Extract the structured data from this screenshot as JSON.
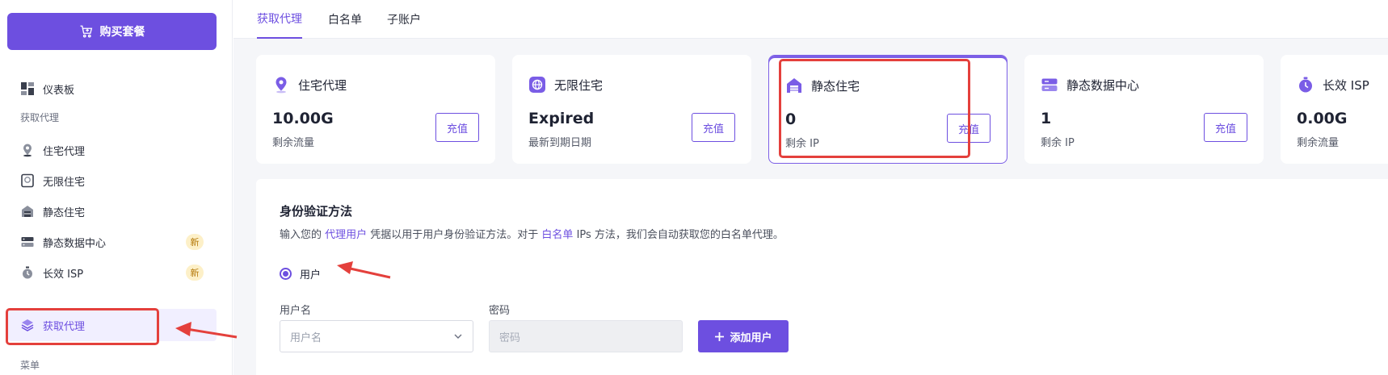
{
  "sidebar": {
    "buy_label": "购买套餐",
    "dashboard_label": "仪表板",
    "section_get_proxy": "获取代理",
    "items": [
      {
        "label": "住宅代理",
        "badge": ""
      },
      {
        "label": "无限住宅",
        "badge": ""
      },
      {
        "label": "静态住宅",
        "badge": ""
      },
      {
        "label": "静态数据中心",
        "badge": "新"
      },
      {
        "label": "长效 ISP",
        "badge": "新"
      },
      {
        "label": "获取代理",
        "badge": ""
      }
    ],
    "section_menu": "菜单"
  },
  "tabs": [
    {
      "label": "获取代理",
      "active": true
    },
    {
      "label": "白名单",
      "active": false
    },
    {
      "label": "子账户",
      "active": false
    }
  ],
  "cards": [
    {
      "title": "住宅代理",
      "value": "10.00G",
      "sub": "剩余流量",
      "button": "充值",
      "icon": "location-pin-icon"
    },
    {
      "title": "无限住宅",
      "value": "Expired",
      "sub": "最新到期日期",
      "button": "充值",
      "icon": "globe-icon"
    },
    {
      "title": "静态住宅",
      "value": "0",
      "sub": "剩余 IP",
      "button": "充值",
      "icon": "building-icon"
    },
    {
      "title": "静态数据中心",
      "value": "1",
      "sub": "剩余 IP",
      "button": "充值",
      "icon": "server-icon"
    },
    {
      "title": "长效 ISP",
      "value": "0.00G",
      "sub": "剩余流量",
      "button": "",
      "icon": "stopwatch-icon"
    }
  ],
  "auth": {
    "title": "身份验证方法",
    "desc_1": "输入您的 ",
    "desc_link_1": "代理用户",
    "desc_2": " 凭据以用于用户身份验证方法。对于 ",
    "desc_link_2": "白名单",
    "desc_3": " IPs 方法，我们会自动获取您的白名单代理。",
    "radio_label": "用户",
    "username_label": "用户名",
    "username_placeholder": "用户名",
    "password_label": "密码",
    "password_placeholder": "密码",
    "add_button": "添加用户"
  },
  "colors": {
    "accent": "#6d4fe0",
    "annotation": "#e4403c"
  }
}
